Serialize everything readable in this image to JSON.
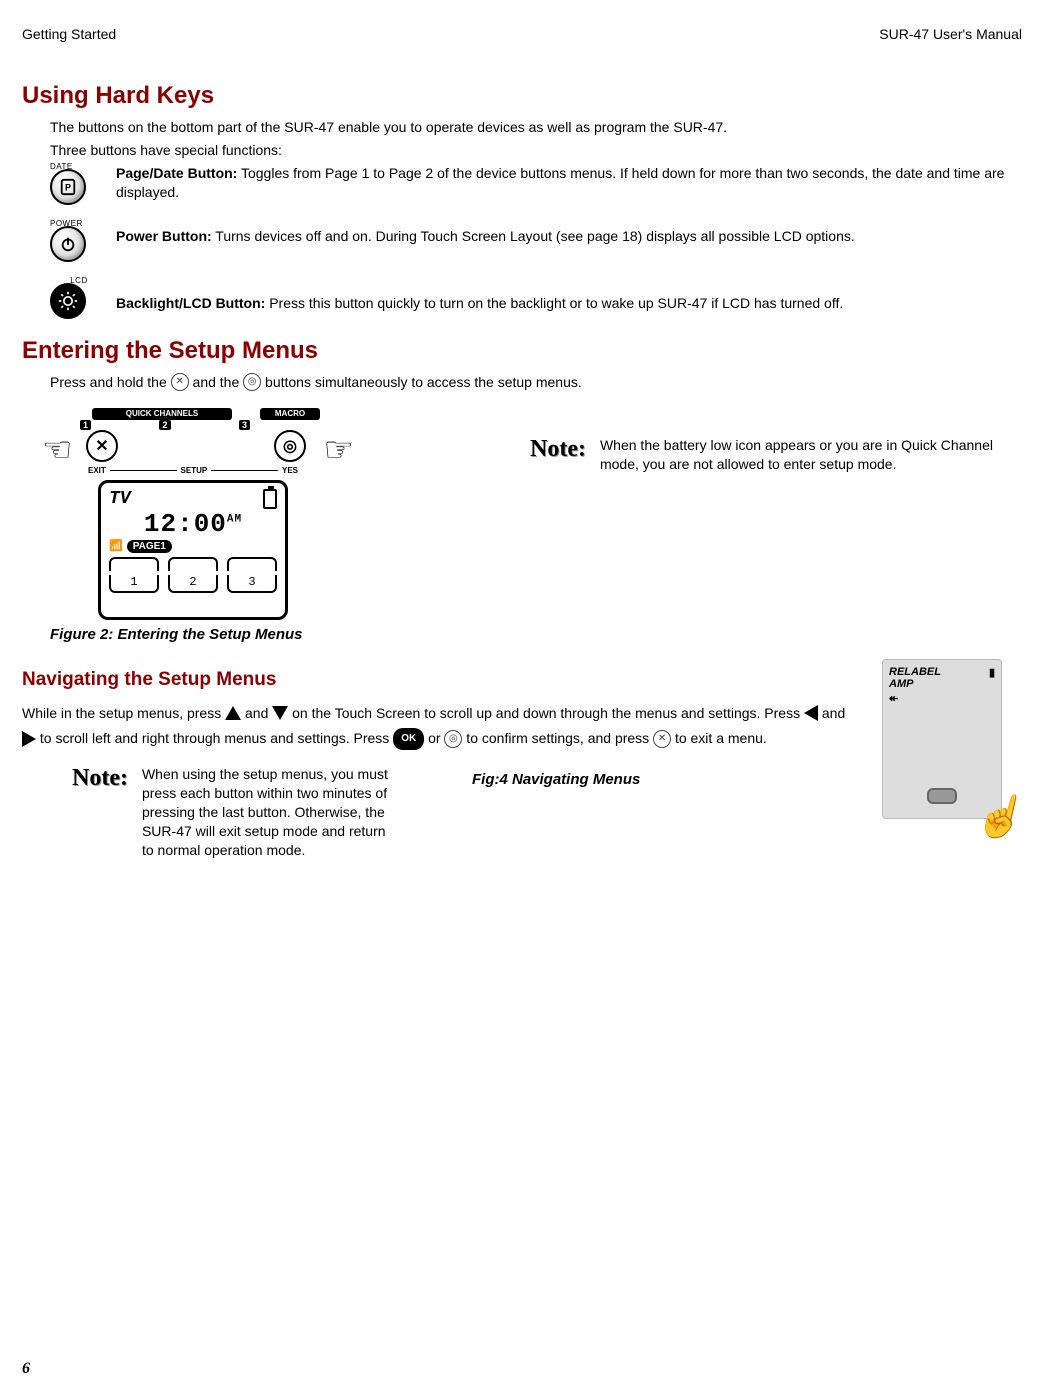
{
  "header": {
    "left": "Getting Started",
    "right": "SUR-47 User's Manual"
  },
  "section_using_hard_keys": {
    "title": "Using Hard Keys",
    "intro1": "The buttons on the bottom part of the SUR-47 enable you to operate devices as well as program the SUR-47.",
    "intro2": "Three buttons have special functions:",
    "buttons": {
      "page_date": {
        "label": "DATE",
        "name": "Page/Date Button:",
        "desc": " Toggles from Page 1 to Page 2 of the device buttons menus. If held down for more than two seconds, the date and time are displayed."
      },
      "power": {
        "label": "POWER",
        "name": "Power Button:",
        "desc": " Turns devices off and on. During Touch Screen Layout (see page 18) displays all possible LCD options."
      },
      "lcd": {
        "label": "LCD",
        "name": "Backlight/LCD Button:",
        "desc": " Press this button quickly to turn on the backlight or to wake up SUR-47 if LCD has turned off."
      }
    }
  },
  "section_entering_setup": {
    "title": "Entering the Setup Menus",
    "intro_pre": "Press and hold the ",
    "intro_mid": " and the ",
    "intro_post": " buttons simultaneously to access the setup menus.",
    "diagram": {
      "quick_channels": "QUICK CHANNELS",
      "macro": "MACRO",
      "exit": "EXIT",
      "setup": "SETUP",
      "yes": "YES",
      "lcd_device": "TV",
      "lcd_time": "12:00",
      "lcd_ampm": "AM",
      "lcd_page": "PAGE1",
      "softkeys": [
        "1",
        "2",
        "3"
      ]
    },
    "note": "When the battery low icon appears or you are in Quick Channel mode, you are not allowed to enter setup mode.",
    "caption": "Figure 2: Entering the Setup Menus"
  },
  "section_navigating": {
    "title": "Navigating the Setup Menus",
    "p1_a": "While in the setup menus, press ",
    "p1_b": " and ",
    "p1_c": " on the Touch Screen to scroll up and down through the menus and settings. Press ",
    "p1_d": " and ",
    "p1_e": " to scroll left and right through menus and settings. Press ",
    "p1_f": " or ",
    "p1_g": " to confirm settings, and press ",
    "p1_h": " to exit a menu.",
    "ok_label": "OK",
    "note": "When using the setup menus, you must press each button within two minutes of pressing the last button. Otherwise, the SUR-47 will exit setup mode and return to normal operation mode.",
    "fig_caption": "Fig:4  Navigating Menus",
    "nav_lcd": {
      "line1": "RELABEL",
      "line2": "AMP"
    }
  },
  "footer": {
    "page_num": "6"
  }
}
